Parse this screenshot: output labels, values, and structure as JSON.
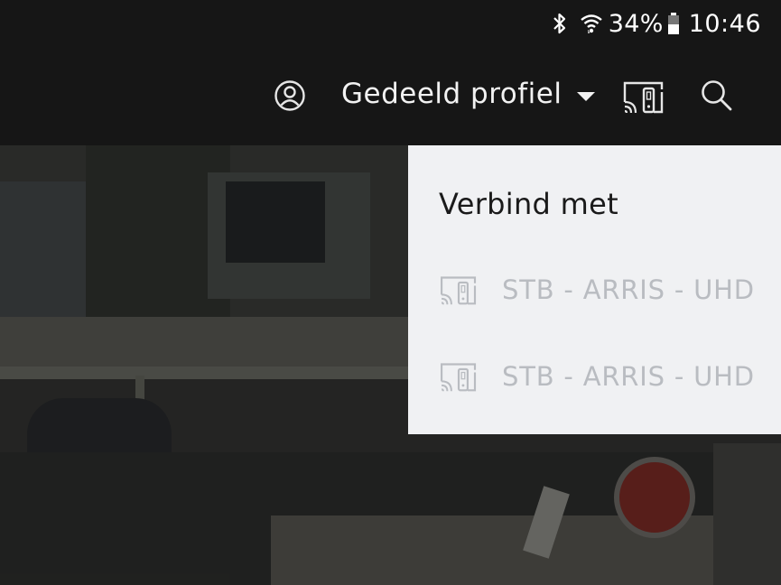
{
  "status_bar": {
    "battery_percent": "34%",
    "time": "10:46",
    "icons": [
      "bluetooth-icon",
      "wifi-icon",
      "battery-icon"
    ]
  },
  "header": {
    "profile_name": "Gedeeld profiel",
    "icons": [
      "profile-icon",
      "dropdown-arrow-icon",
      "cast-icon",
      "search-icon"
    ]
  },
  "cast_panel": {
    "title": "Verbind met",
    "devices": [
      {
        "label": "STB - ARRIS - UHD"
      },
      {
        "label": "STB - ARRIS - UHD"
      }
    ]
  },
  "colors": {
    "header_bg": "#161616",
    "panel_bg": "#f0f1f3",
    "device_text": "#b9bcc1",
    "title_text": "#1a1a1a"
  }
}
